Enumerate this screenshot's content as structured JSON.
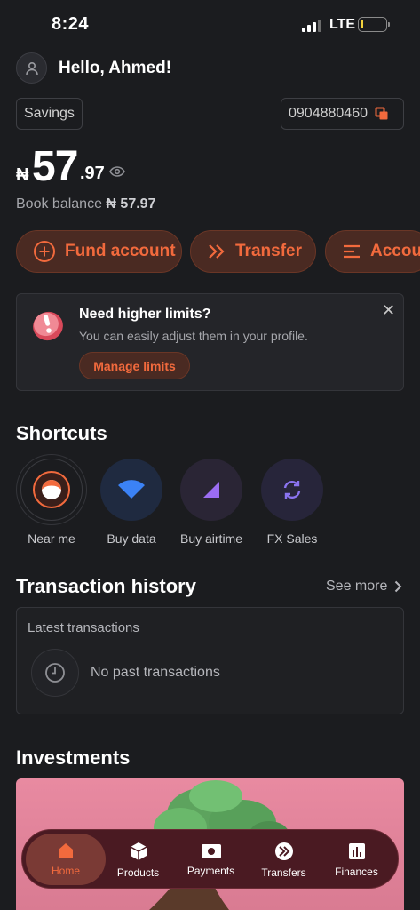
{
  "status_bar": {
    "time": "8:24",
    "network": "LTE"
  },
  "header": {
    "greeting": "Hello, Ahmed!"
  },
  "account": {
    "type": "Savings",
    "number": "0904880460",
    "currency_symbol": "₦",
    "balance_whole": "57",
    "balance_decimal": ".97",
    "book_balance_label": "Book balance",
    "book_balance_value": "₦ 57.97"
  },
  "actions": [
    {
      "label": "Fund account",
      "icon": "plus-circle-icon"
    },
    {
      "label": "Transfer",
      "icon": "double-chevron-right-icon"
    },
    {
      "label": "Accou",
      "icon": "menu-lines-icon"
    }
  ],
  "limits_card": {
    "title": "Need higher limits?",
    "subtitle": "You can easily adjust them in your profile.",
    "button": "Manage limits",
    "close": "✕"
  },
  "shortcuts": {
    "title": "Shortcuts",
    "items": [
      {
        "label": "Near me",
        "icon": "location-pin-icon"
      },
      {
        "label": "Buy data",
        "icon": "wifi-icon"
      },
      {
        "label": "Buy airtime",
        "icon": "signal-triangle-icon"
      },
      {
        "label": "FX Sales",
        "icon": "exchange-icon"
      }
    ]
  },
  "transactions": {
    "title": "Transaction history",
    "see_more": "See more",
    "latest_label": "Latest transactions",
    "empty_text": "No past transactions"
  },
  "investments": {
    "title": "Investments"
  },
  "bottom_nav": [
    {
      "label": "Home",
      "icon": "home-icon",
      "active": true
    },
    {
      "label": "Products",
      "icon": "box-icon",
      "active": false
    },
    {
      "label": "Payments",
      "icon": "banknote-icon",
      "active": false
    },
    {
      "label": "Transfers",
      "icon": "transfer-circle-icon",
      "active": false
    },
    {
      "label": "Finances",
      "icon": "bar-chart-icon",
      "active": false
    }
  ],
  "colors": {
    "background": "#1b1c1f",
    "accent": "#f26a3d",
    "pill_bg": "#4a2a22",
    "nav_bg": "#4a1a22"
  }
}
